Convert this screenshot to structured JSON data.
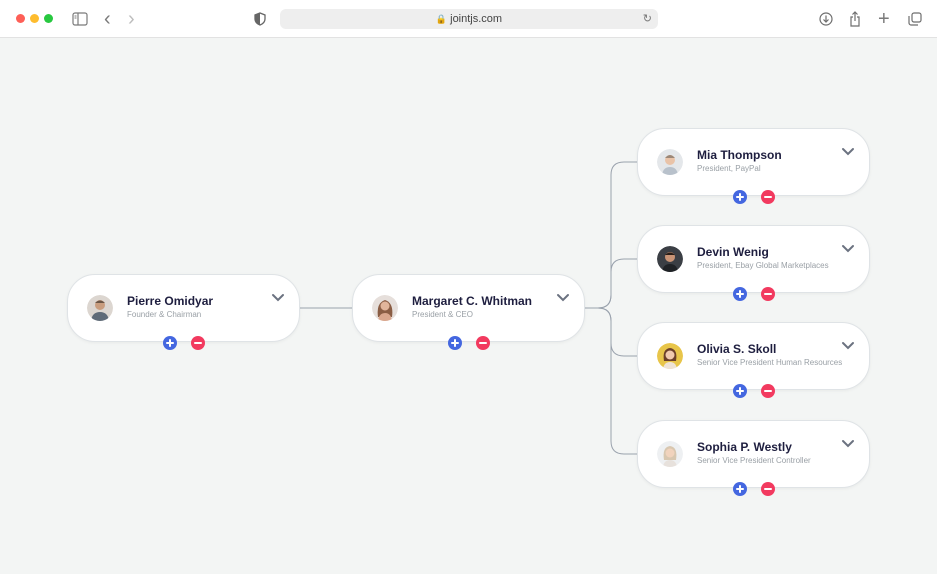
{
  "browser": {
    "url": "jointjs.com",
    "lock_glyph": "🔒",
    "reload_glyph": "↻",
    "back_glyph": "‹",
    "forward_glyph": "›",
    "new_tab_glyph": "+"
  },
  "colors": {
    "add": "#4467e0",
    "remove": "#f23a5f",
    "link": "#9aa2ad",
    "name": "#1e1e3f",
    "title": "#9aa0a6"
  },
  "nodes": [
    {
      "name": "Pierre Omidyar",
      "title": "Founder & Chairman"
    },
    {
      "name": "Margaret C. Whitman",
      "title": "President & CEO"
    },
    {
      "name": "Mia Thompson",
      "title": "President, PayPal"
    },
    {
      "name": "Devin Wenig",
      "title": "President, Ebay Global Marketplaces"
    },
    {
      "name": "Olivia S. Skoll",
      "title": "Senior Vice President Human Resources"
    },
    {
      "name": "Sophia P. Westly",
      "title": "Senior Vice President Controller"
    }
  ]
}
